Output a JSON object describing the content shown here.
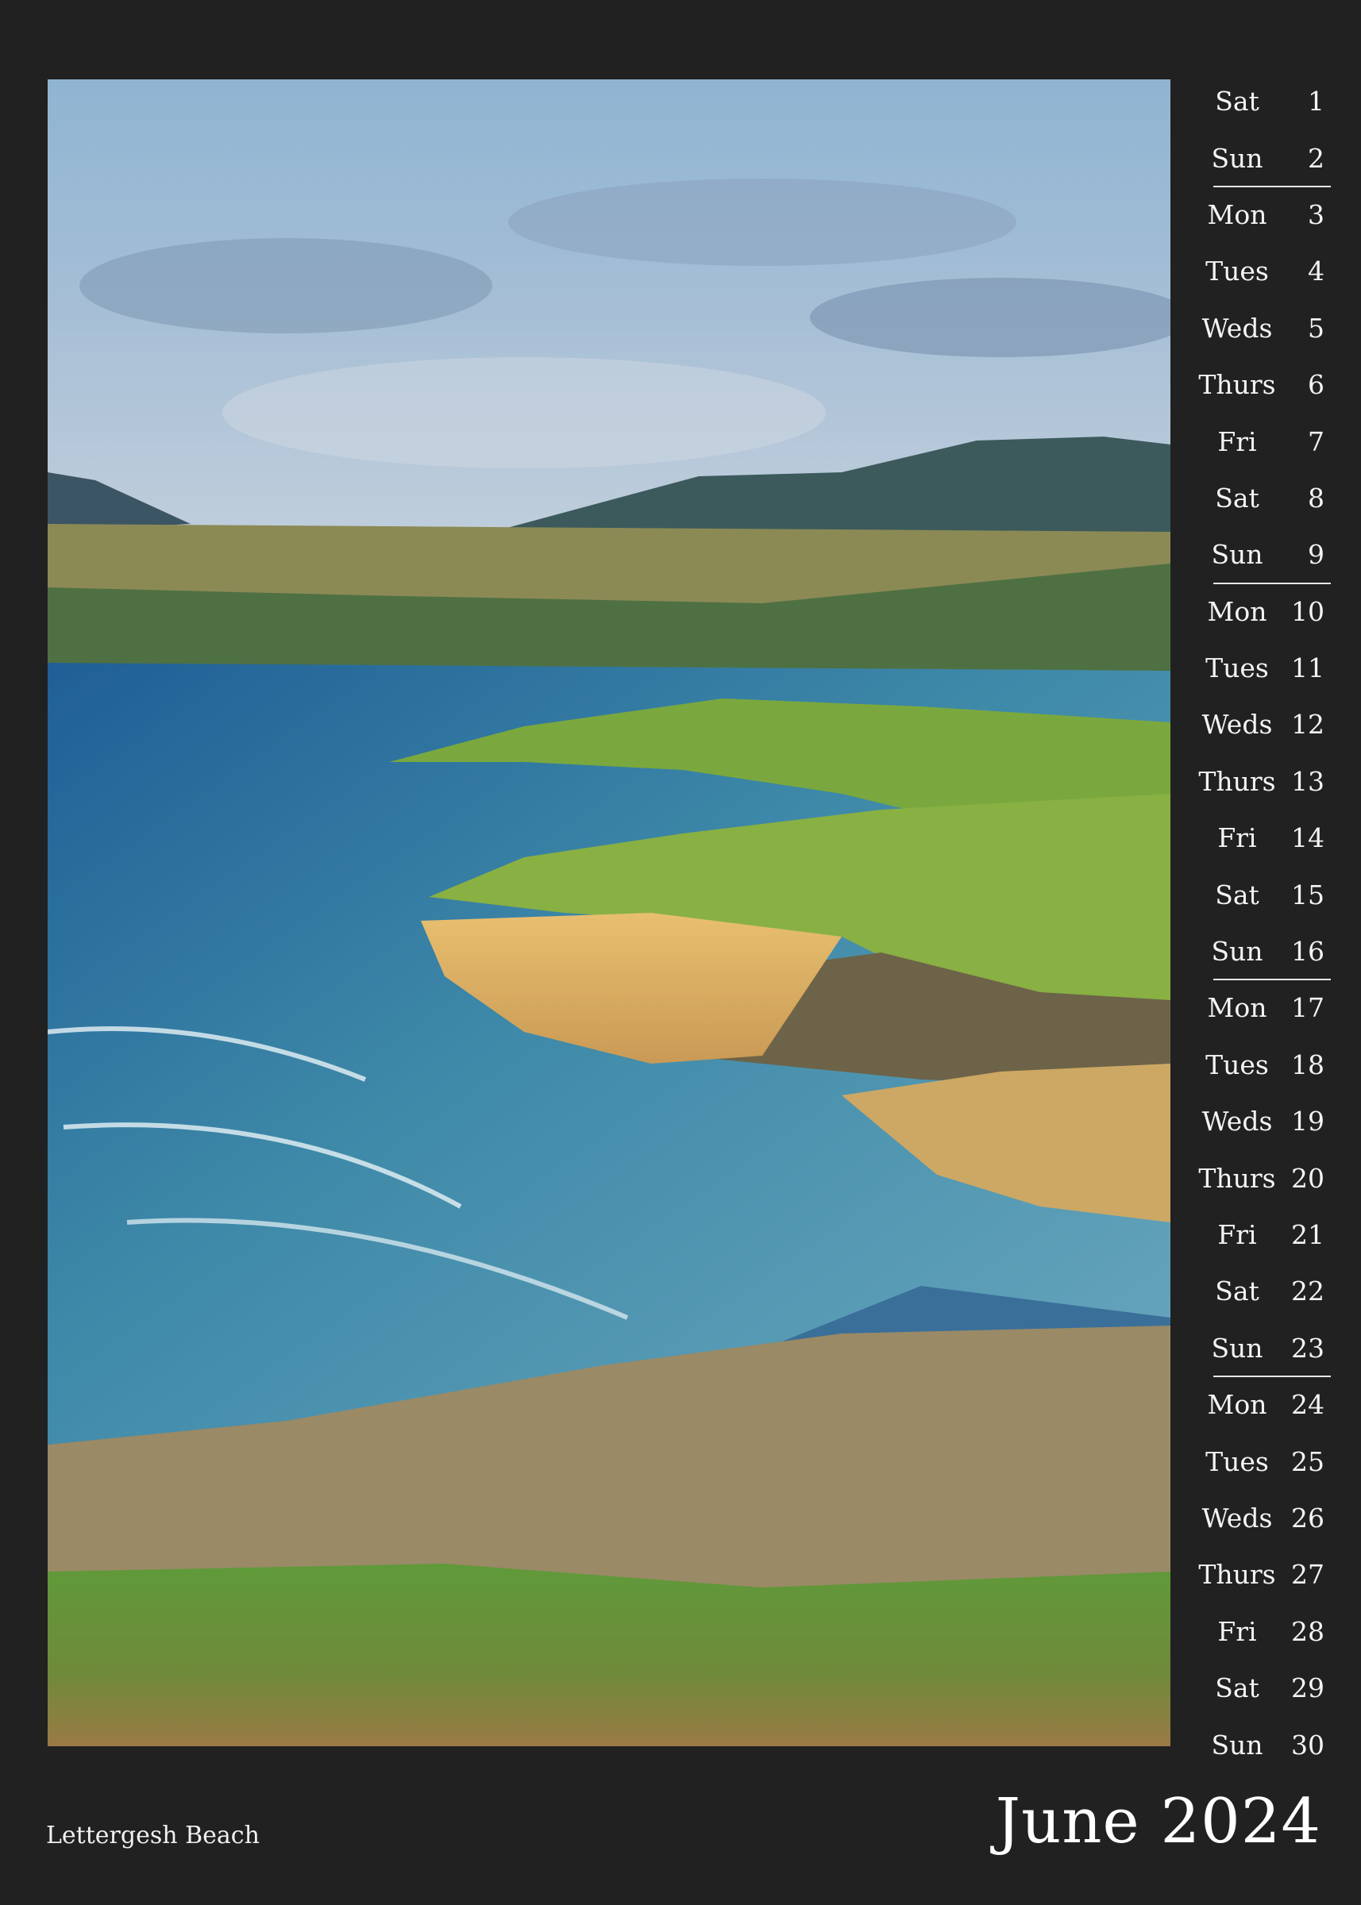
{
  "photo": {
    "caption": "Lettergesh Beach",
    "icon": "landscape-photo"
  },
  "calendar": {
    "month_label": "June 2024",
    "days": [
      {
        "name": "Sat",
        "num": "1"
      },
      {
        "name": "Sun",
        "num": "2"
      },
      {
        "name": "Mon",
        "num": "3"
      },
      {
        "name": "Tues",
        "num": "4"
      },
      {
        "name": "Weds",
        "num": "5"
      },
      {
        "name": "Thurs",
        "num": "6"
      },
      {
        "name": "Fri",
        "num": "7"
      },
      {
        "name": "Sat",
        "num": "8"
      },
      {
        "name": "Sun",
        "num": "9"
      },
      {
        "name": "Mon",
        "num": "10"
      },
      {
        "name": "Tues",
        "num": "11"
      },
      {
        "name": "Weds",
        "num": "12"
      },
      {
        "name": "Thurs",
        "num": "13"
      },
      {
        "name": "Fri",
        "num": "14"
      },
      {
        "name": "Sat",
        "num": "15"
      },
      {
        "name": "Sun",
        "num": "16"
      },
      {
        "name": "Mon",
        "num": "17"
      },
      {
        "name": "Tues",
        "num": "18"
      },
      {
        "name": "Weds",
        "num": "19"
      },
      {
        "name": "Thurs",
        "num": "20"
      },
      {
        "name": "Fri",
        "num": "21"
      },
      {
        "name": "Sat",
        "num": "22"
      },
      {
        "name": "Sun",
        "num": "23"
      },
      {
        "name": "Mon",
        "num": "24"
      },
      {
        "name": "Tues",
        "num": "25"
      },
      {
        "name": "Weds",
        "num": "26"
      },
      {
        "name": "Thurs",
        "num": "27"
      },
      {
        "name": "Fri",
        "num": "28"
      },
      {
        "name": "Sat",
        "num": "29"
      },
      {
        "name": "Sun",
        "num": "30"
      }
    ]
  },
  "colors": {
    "background": "#212121",
    "text": "#f4f4f4"
  }
}
